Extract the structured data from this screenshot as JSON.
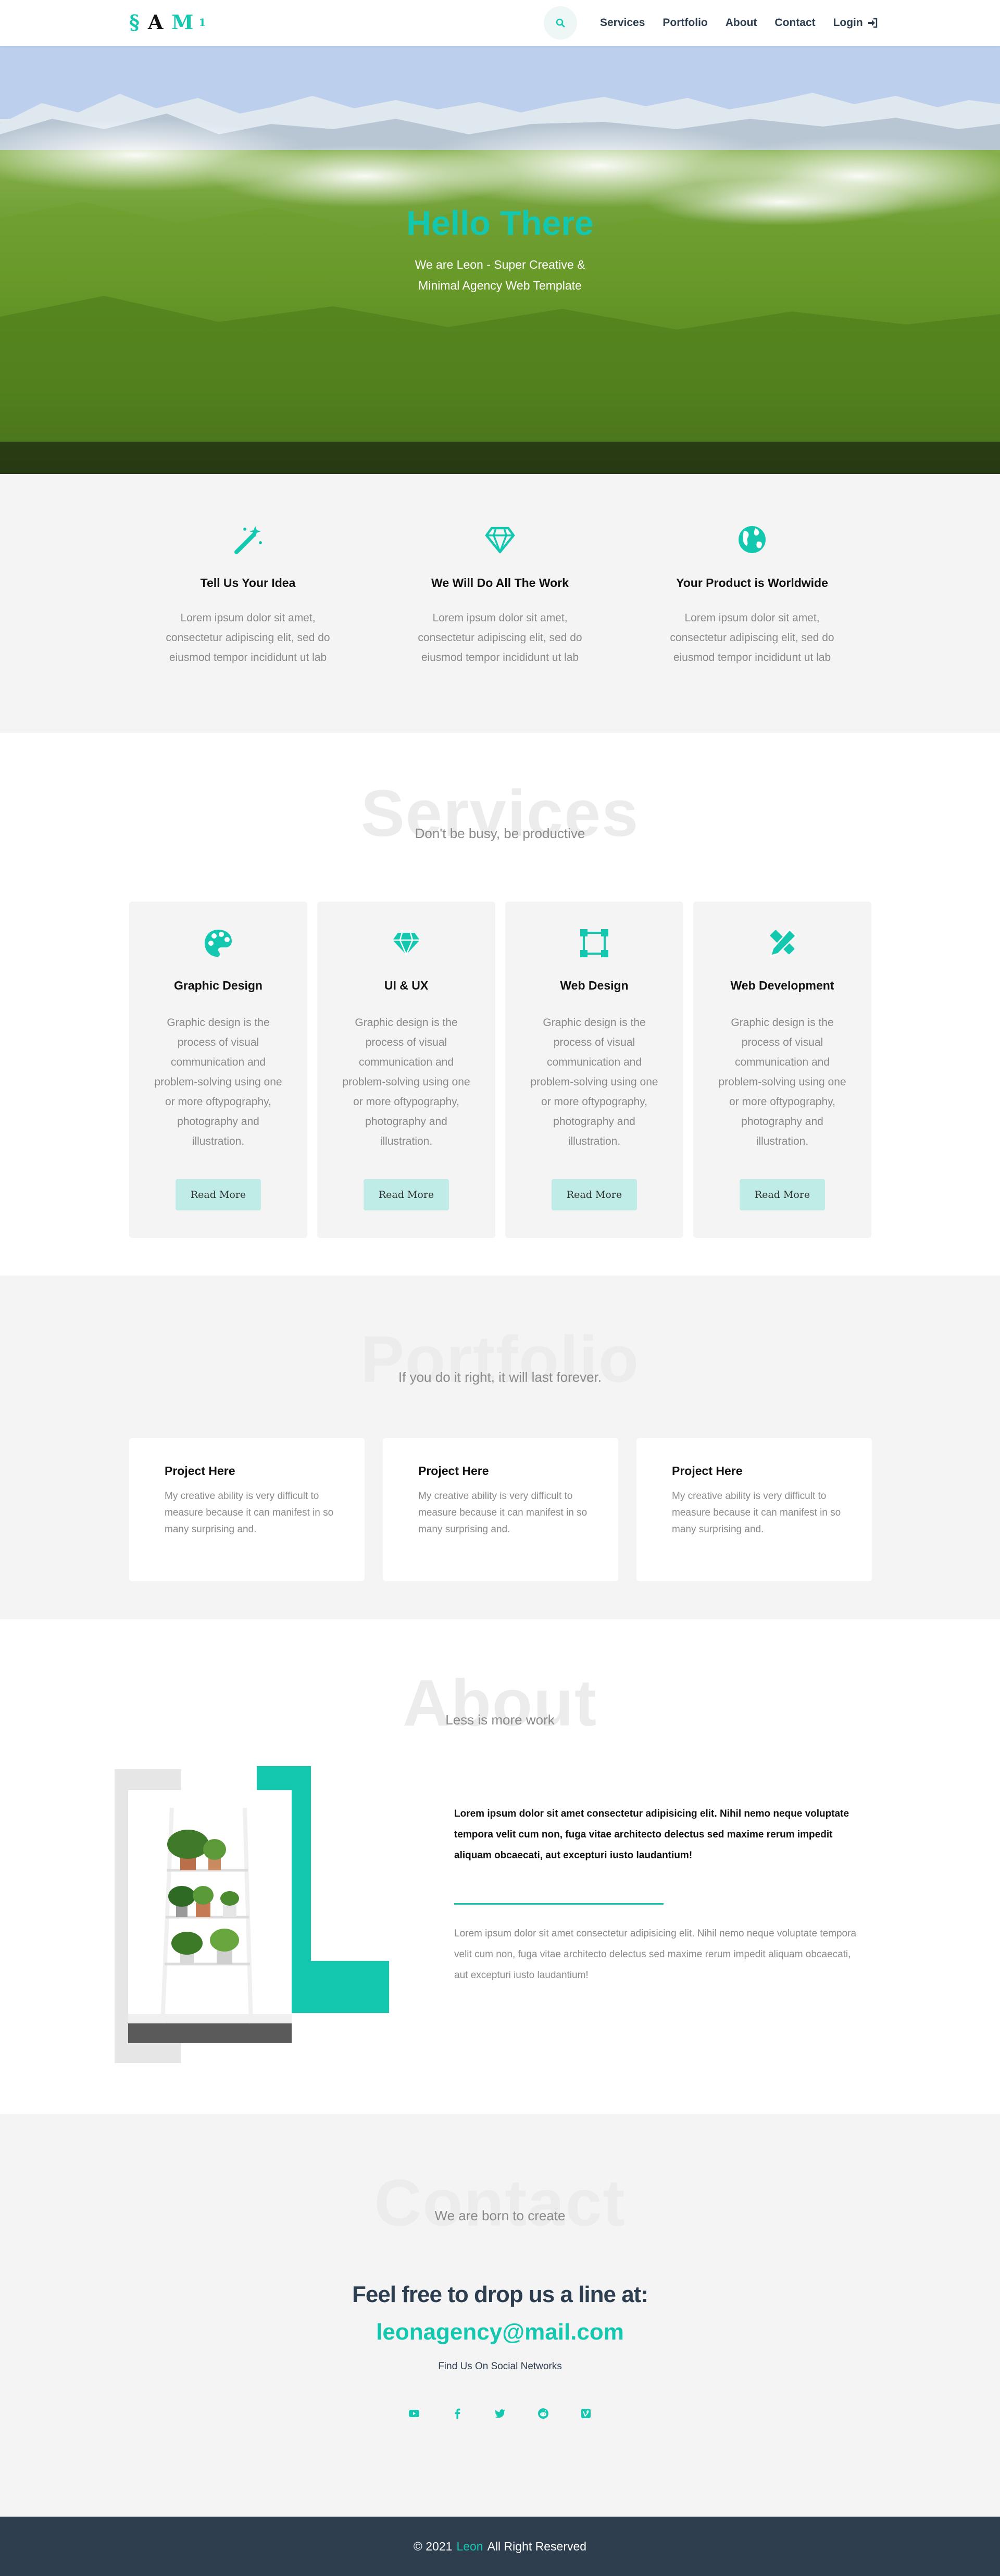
{
  "nav": {
    "logo_letters": [
      "§",
      "A",
      "M",
      "1"
    ],
    "search_icon": "search-icon",
    "links": [
      "Services",
      "Portfolio",
      "About",
      "Contact"
    ],
    "login_label": "Login",
    "login_icon": "sign-in-icon"
  },
  "hero": {
    "title": "Hello There",
    "subtitle": "We are Leon - Super Creative & Minimal Agency Web Template"
  },
  "features": [
    {
      "icon": "magic-wand-icon",
      "title": "Tell Us Your Idea",
      "text": "Lorem ipsum dolor sit amet, consectetur adipiscing elit, sed do eiusmod tempor incididunt ut lab"
    },
    {
      "icon": "diamond-icon",
      "title": "We Will Do All The Work",
      "text": "Lorem ipsum dolor sit amet, consectetur adipiscing elit, sed do eiusmod tempor incididunt ut lab"
    },
    {
      "icon": "globe-icon",
      "title": "Your Product is Worldwide",
      "text": "Lorem ipsum dolor sit amet, consectetur adipiscing elit, sed do eiusmod tempor incididunt ut lab"
    }
  ],
  "services": {
    "heading_bg": "Services",
    "subtitle": "Don't be busy, be productive",
    "cards": [
      {
        "icon": "palette-icon",
        "title": "Graphic Design",
        "text": "Graphic design is the process of visual communication and problem-solving using one or more oftypography, photography and illustration.",
        "button": "Read More"
      },
      {
        "icon": "diamond-icon",
        "title": "UI & UX",
        "text": "Graphic design is the process of visual communication and problem-solving using one or more oftypography, photography and illustration.",
        "button": "Read More"
      },
      {
        "icon": "vector-square-icon",
        "title": "Web Design",
        "text": "Graphic design is the process of visual communication and problem-solving using one or more oftypography, photography and illustration.",
        "button": "Read More"
      },
      {
        "icon": "pencil-ruler-icon",
        "title": "Web Development",
        "text": "Graphic design is the process of visual communication and problem-solving using one or more oftypography, photography and illustration.",
        "button": "Read More"
      }
    ]
  },
  "portfolio": {
    "heading_bg": "Portfolio",
    "subtitle": "If you do it right, it will last forever.",
    "cards": [
      {
        "title": "Project Here",
        "text": "My creative ability is very difficult to measure because it can manifest in so many surprising and."
      },
      {
        "title": "Project Here",
        "text": "My creative ability is very difficult to measure because it can manifest in so many surprising and."
      },
      {
        "title": "Project Here",
        "text": "My creative ability is very difficult to measure because it can manifest in so many surprising and."
      }
    ]
  },
  "about": {
    "heading_bg": "About",
    "subtitle": "Less is more work",
    "lead": "Lorem ipsum dolor sit amet consectetur adipisicing elit. Nihil nemo neque voluptate tempora velit cum non, fuga vitae architecto delectus sed maxime rerum impedit aliquam obcaecati, aut excepturi iusto laudantium!",
    "text": "Lorem ipsum dolor sit amet consectetur adipisicing elit. Nihil nemo neque voluptate tempora velit cum non, fuga vitae architecto delectus sed maxime rerum impedit aliquam obcaecati, aut excepturi iusto laudantium!"
  },
  "contact": {
    "heading_bg": "Contact",
    "subtitle": "We are born to create",
    "headline": "Feel free to drop us a line at:",
    "email": "leonagency@mail.com",
    "social_label": "Find Us On Social Networks",
    "social_icons": [
      "youtube-icon",
      "facebook-icon",
      "twitter-icon",
      "reddit-icon",
      "vine-icon"
    ]
  },
  "footer": {
    "prefix": "© 2021",
    "brand": "Leon",
    "suffix": "All Right Reserved"
  },
  "colors": {
    "accent": "#14c8b0",
    "dark": "#2d3e50",
    "footer_bg": "#2e3e4f",
    "section_gray": "#f4f4f4"
  }
}
